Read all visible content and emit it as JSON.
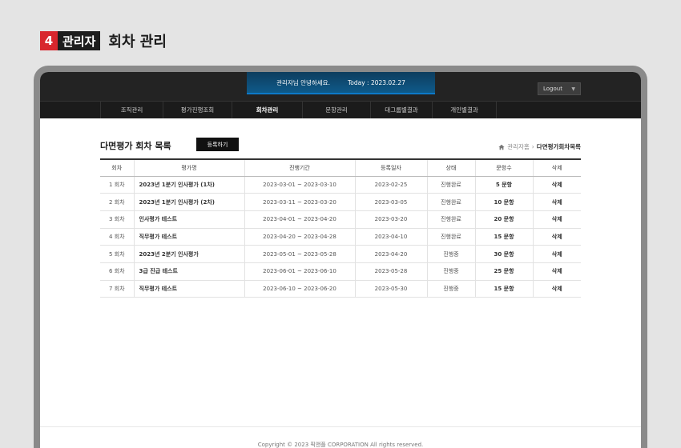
{
  "step": {
    "number": "4",
    "badge": "관리자",
    "title": "회차 관리"
  },
  "topbar": {
    "greeting": "관리자님 안녕하세요.",
    "today": "Today : 2023.02.27",
    "logout_label": "Logout"
  },
  "nav": {
    "items": [
      {
        "label": "조직관리"
      },
      {
        "label": "평가진행조회"
      },
      {
        "label": "회차관리",
        "active": true
      },
      {
        "label": "문항관리"
      },
      {
        "label": "대그룹별결과"
      },
      {
        "label": "개인별결과"
      }
    ]
  },
  "section": {
    "title": "다면평가 회차 목록",
    "register_label": "등록하기",
    "breadcrumb_root": "관리자홈",
    "breadcrumb_current": "다면평가회차목록"
  },
  "table": {
    "headers": [
      "회차",
      "평가명",
      "진행기간",
      "등록일자",
      "상태",
      "문항수",
      "삭제"
    ],
    "rows": [
      [
        "1 회차",
        "2023년 1분기 인사평가 (1차)",
        "2023-03-01 ~ 2023-03-10",
        "2023-02-25",
        "진행완료",
        "5 문항",
        "삭제"
      ],
      [
        "2 회차",
        "2023년 1분기 인사평가 (2차)",
        "2023-03-11 ~ 2023-03-20",
        "2023-03-05",
        "진행완료",
        "10 문항",
        "삭제"
      ],
      [
        "3 회차",
        "인사평가 테스트",
        "2023-04-01 ~ 2023-04-20",
        "2023-03-20",
        "진행완료",
        "20 문항",
        "삭제"
      ],
      [
        "4 회차",
        "직무평가 테스트",
        "2023-04-20 ~ 2023-04-28",
        "2023-04-10",
        "진행완료",
        "15 문항",
        "삭제"
      ],
      [
        "5 회차",
        "2023년 2분기 인사평가",
        "2023-05-01 ~ 2023-05-28",
        "2023-04-20",
        "진행중",
        "30 문항",
        "삭제"
      ],
      [
        "6 회차",
        "3급 진급 테스트",
        "2023-06-01 ~ 2023-06-10",
        "2023-05-28",
        "진행중",
        "25 문항",
        "삭제"
      ],
      [
        "7 회차",
        "직무평가 테스트",
        "2023-06-10 ~ 2023-06-20",
        "2023-05-30",
        "진행중",
        "15 문항",
        "삭제"
      ]
    ]
  },
  "footer": {
    "copyright": "Copyright © 2023 픽앤플 CORPORATION All rights reserved."
  },
  "colors": {
    "accent_red": "#d8262d",
    "header_blue": "#0e5a8a",
    "dark_bar": "#232323"
  }
}
